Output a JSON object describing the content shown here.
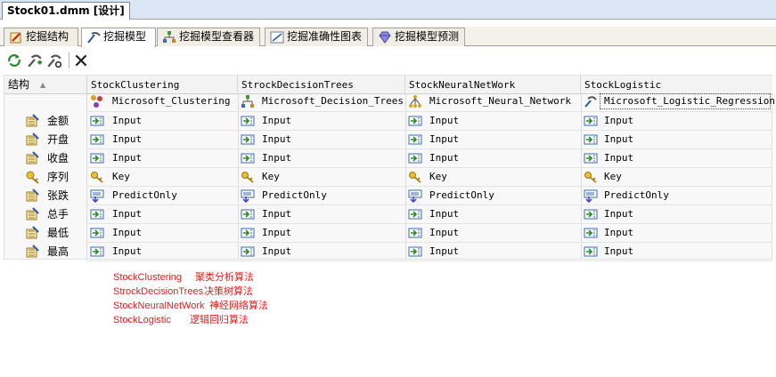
{
  "document_tab": "Stock01.dmm [设计]",
  "designer_tabs": [
    {
      "label": "挖掘结构",
      "icon": "mining-structure-icon"
    },
    {
      "label": "挖掘模型",
      "icon": "mining-model-icon"
    },
    {
      "label": "挖掘模型查看器",
      "icon": "model-viewer-icon"
    },
    {
      "label": "挖掘准确性图表",
      "icon": "accuracy-chart-icon"
    },
    {
      "label": "挖掘模型预测",
      "icon": "prediction-icon"
    }
  ],
  "toolbar": {
    "buttons": [
      "process-icon",
      "new-model-icon",
      "set-algorithm-icon",
      "delete-icon"
    ]
  },
  "grid": {
    "structure_header": "结构",
    "sort_glyph": "▲",
    "models": [
      {
        "name": "StockClustering",
        "algorithm": "Microsoft_Clustering",
        "icon": "clustering-icon"
      },
      {
        "name": "StrockDecisionTrees",
        "algorithm": "Microsoft_Decision_Trees",
        "icon": "decision-trees-icon"
      },
      {
        "name": "StockNeuralNetWork",
        "algorithm": "Microsoft_Neural_Network",
        "icon": "neural-network-icon"
      },
      {
        "name": "StockLogistic",
        "algorithm": "Microsoft_Logistic_Regression",
        "icon": "logistic-regression-icon"
      }
    ],
    "rows": [
      {
        "column": "金额",
        "icon": "column-icon",
        "usage": [
          "Input",
          "Input",
          "Input",
          "Input"
        ],
        "usage_icon": "input-icon"
      },
      {
        "column": "开盘",
        "icon": "column-icon",
        "usage": [
          "Input",
          "Input",
          "Input",
          "Input"
        ],
        "usage_icon": "input-icon"
      },
      {
        "column": "收盘",
        "icon": "column-icon",
        "usage": [
          "Input",
          "Input",
          "Input",
          "Input"
        ],
        "usage_icon": "input-icon"
      },
      {
        "column": "序列",
        "icon": "key-column-icon",
        "usage": [
          "Key",
          "Key",
          "Key",
          "Key"
        ],
        "usage_icon": "key-icon"
      },
      {
        "column": "张跌",
        "icon": "column-icon",
        "usage": [
          "PredictOnly",
          "PredictOnly",
          "PredictOnly",
          "PredictOnly"
        ],
        "usage_icon": "predict-icon"
      },
      {
        "column": "总手",
        "icon": "column-icon",
        "usage": [
          "Input",
          "Input",
          "Input",
          "Input"
        ],
        "usage_icon": "input-icon"
      },
      {
        "column": "最低",
        "icon": "column-icon",
        "usage": [
          "Input",
          "Input",
          "Input",
          "Input"
        ],
        "usage_icon": "input-icon"
      },
      {
        "column": "最高",
        "icon": "column-icon",
        "usage": [
          "Input",
          "Input",
          "Input",
          "Input"
        ],
        "usage_icon": "input-icon"
      }
    ]
  },
  "notes": [
    {
      "model": "StockClustering",
      "desc": "聚类分析算法"
    },
    {
      "model": "StrockDecisionTrees",
      "desc": "决策树算法"
    },
    {
      "model": "StockNeuralNetWork",
      "desc": "神经网络算法"
    },
    {
      "model": "StockLogistic",
      "desc": "逻辑回归算法"
    }
  ],
  "colors": {
    "note_text": "#e02020",
    "header_bg": "#f3f3f3",
    "tab_strip": "#dbe6f4"
  }
}
